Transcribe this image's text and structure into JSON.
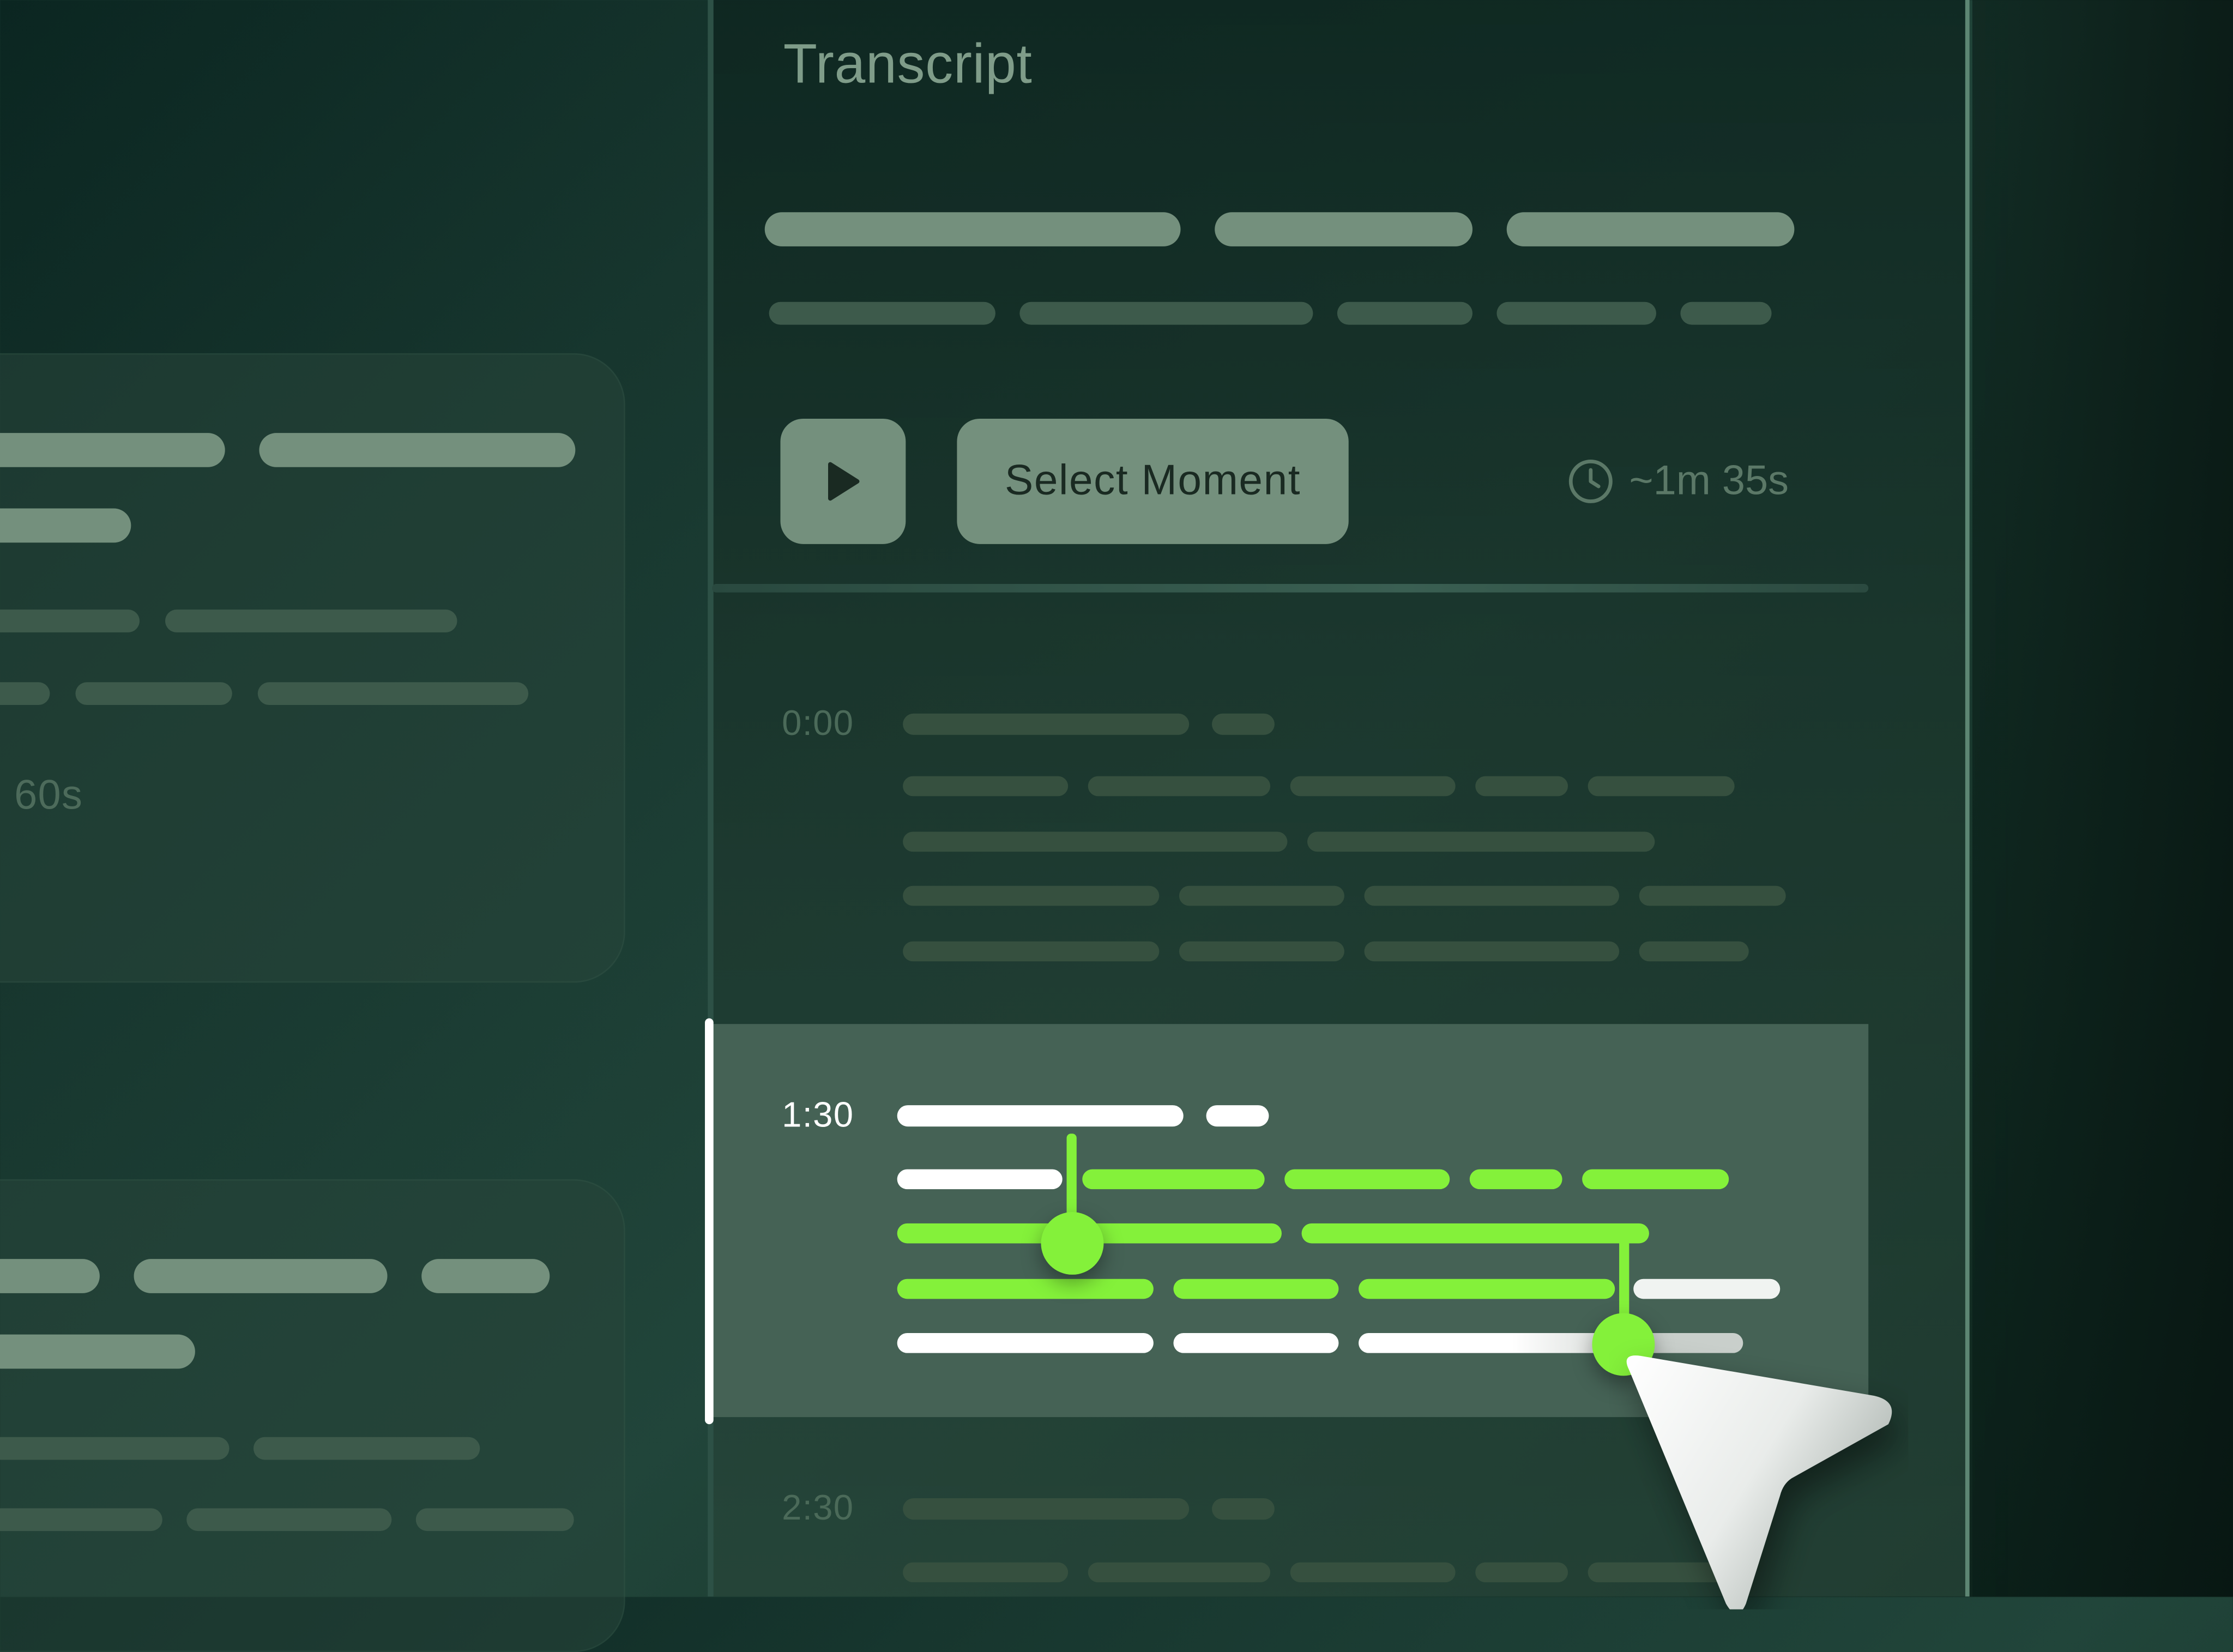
{
  "panel": {
    "title": "Transcript"
  },
  "toolbar": {
    "play_icon": "play-icon",
    "select_moment_label": "Select Moment",
    "duration_icon": "clock-icon",
    "duration_text": "~1m 35s"
  },
  "left_cards": {
    "duration_text": "60s"
  },
  "segments": [
    {
      "timestamp": "0:00",
      "state": "inactive"
    },
    {
      "timestamp": "1:30",
      "state": "selected"
    },
    {
      "timestamp": "2:30",
      "state": "inactive"
    }
  ],
  "colors": {
    "accent_green": "#84f13a",
    "placeholder": "#74907d",
    "highlight_bg": "#456255"
  }
}
